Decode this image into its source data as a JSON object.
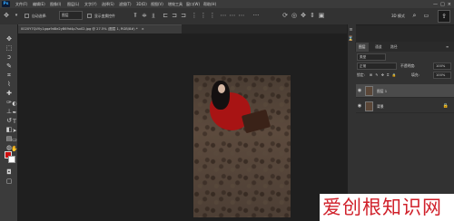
{
  "app": {
    "logo": "Ps"
  },
  "menu": [
    "文件(F)",
    "编辑(E)",
    "图像(I)",
    "图层(L)",
    "文字(Y)",
    "选择(S)",
    "滤镜(T)",
    "3D(D)",
    "视图(V)",
    "增效工具",
    "窗口(W)",
    "帮助(H)"
  ],
  "window_controls": {
    "min": "—",
    "max": "□",
    "close": "×"
  },
  "options": {
    "auto_select_label": "自动选择:",
    "auto_select_value": "图层",
    "show_transform_label": "显示变换控件",
    "mode_3d": "3D 模式",
    "search_icon": "search-icon",
    "share_icon": "share-icon"
  },
  "document": {
    "tab_title": "0020Y7QLYly1gqa9d8e2yB69d4p7sx02.jpg @ 27.5% (图层 1, RGB/8#) *",
    "close": "×"
  },
  "colors": {
    "foreground": "#cc0e0e",
    "background": "#ffffff",
    "accent": "#31a8ff"
  },
  "tools": [
    "move-icon",
    "marquee-icon",
    "lasso-icon",
    "quick-select-icon",
    "crop-icon",
    "eyedropper-icon",
    "healing-icon",
    "brush-icon",
    "stamp-icon",
    "history-brush-icon",
    "eraser-icon",
    "gradient-icon",
    "blur-icon",
    "dodge-icon",
    "pen-icon",
    "type-icon",
    "path-select-icon",
    "shape-icon",
    "hand-icon",
    "zoom-icon",
    "more-icon"
  ],
  "panel": {
    "tabs": [
      "图层",
      "通道",
      "路径"
    ],
    "filter": "类型",
    "blend_mode": "正常",
    "opacity_label": "不透明度:",
    "opacity_value": "100%",
    "lock_label": "锁定:",
    "fill_label": "填充:",
    "fill_value": "100%",
    "layers": [
      {
        "name": "图层 1",
        "selected": true
      },
      {
        "name": "背景",
        "selected": false
      }
    ]
  },
  "watermark": "爱创根知识网"
}
